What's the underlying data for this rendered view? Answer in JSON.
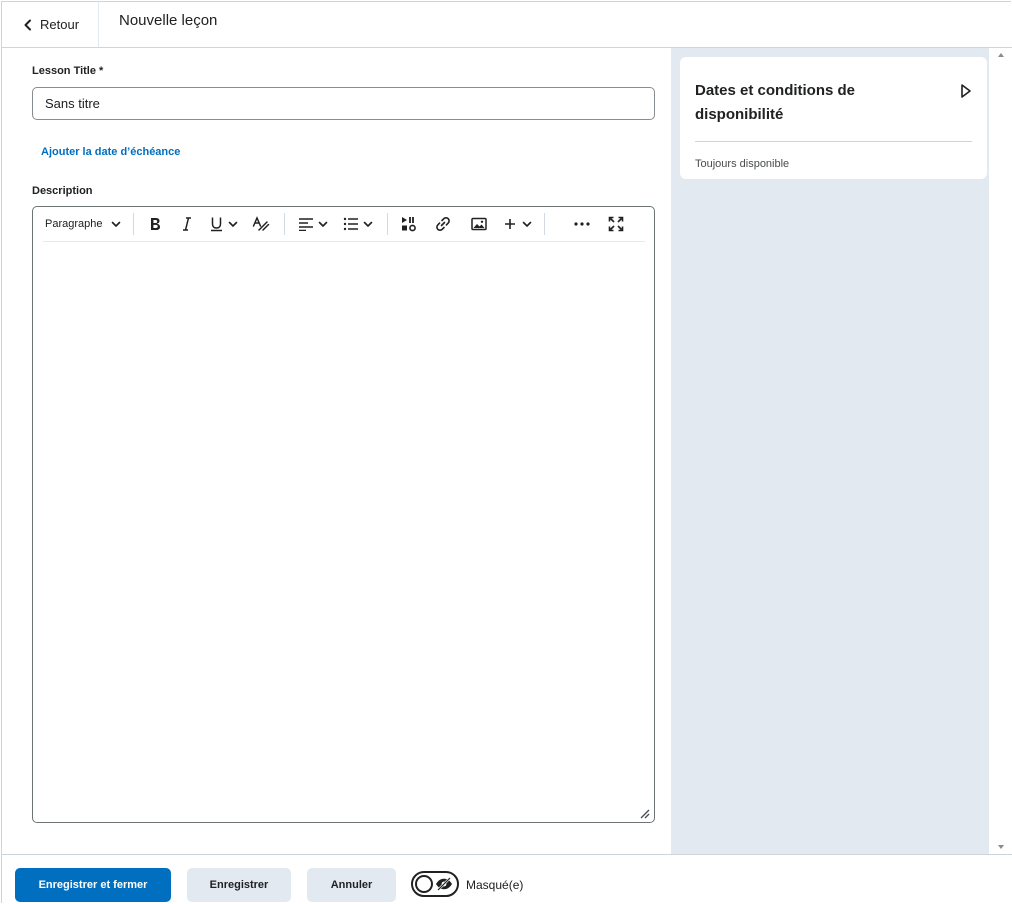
{
  "header": {
    "back_label": "Retour",
    "title": "Nouvelle leçon"
  },
  "form": {
    "title_label": "Lesson Title *",
    "title_value": "Sans titre",
    "due_date_link": "Ajouter la date d’échéance",
    "description_label": "Description",
    "editor": {
      "paragraph_style": "Paragraphe"
    }
  },
  "side_panel": {
    "card_title": "Dates et conditions de disponibilité",
    "status": "Toujours disponible"
  },
  "footer": {
    "save_close_label": "Enregistrer et fermer",
    "save_label": "Enregistrer",
    "cancel_label": "Annuler",
    "hidden_label": "Masqué(e)"
  },
  "colors": {
    "primary": "#006fbf",
    "panel_bg": "#e3e9f1"
  }
}
